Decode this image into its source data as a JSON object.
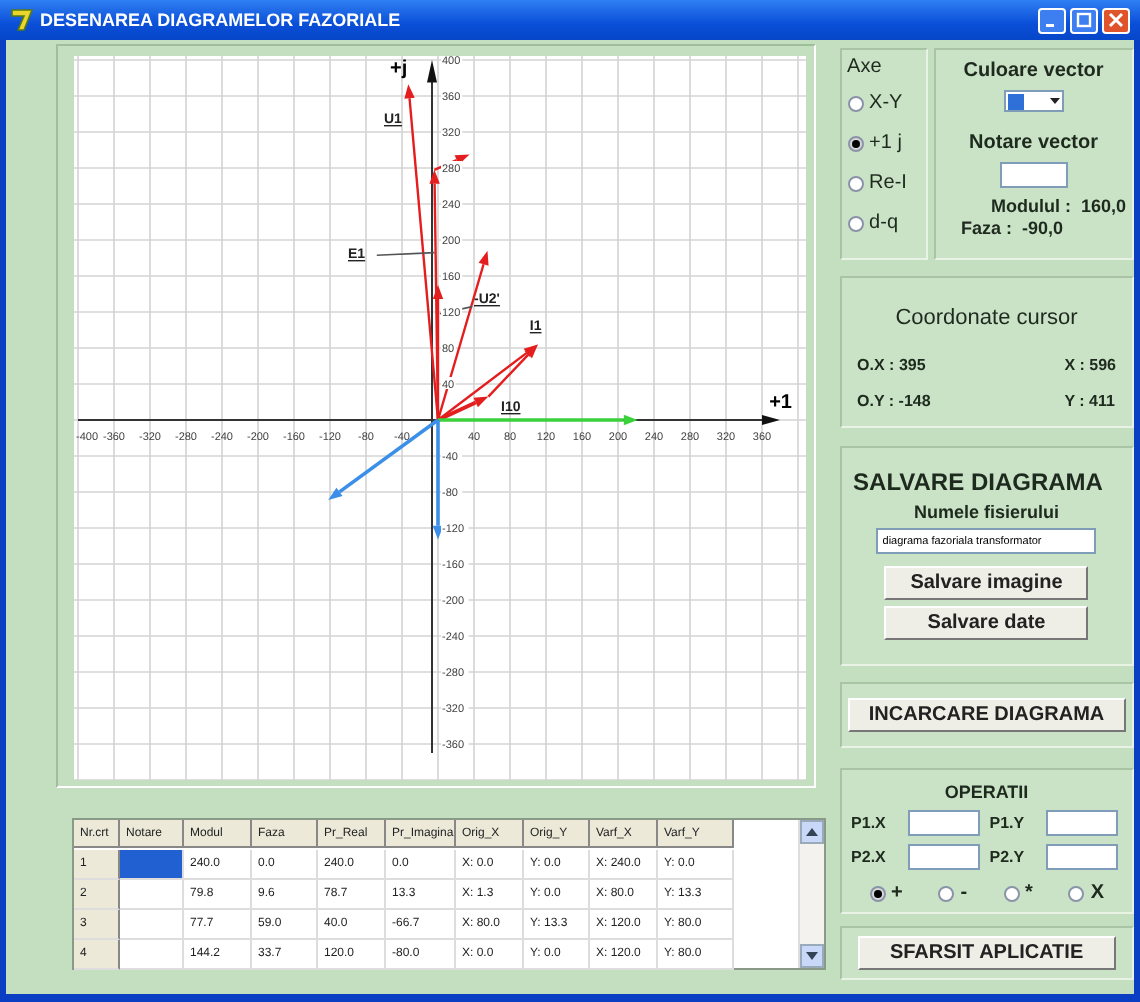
{
  "window": {
    "title": "DESENAREA DIAGRAMELOR FAZORIALE"
  },
  "plot": {
    "x_axis_label": "+1",
    "y_axis_label": "+j",
    "x_ticks": [
      "-400",
      "-360",
      "-320",
      "-280",
      "-240",
      "-200",
      "-160",
      "-120",
      "-80",
      "-40",
      "40",
      "80",
      "120",
      "160",
      "200",
      "240",
      "280",
      "320",
      "360"
    ],
    "y_ticks": [
      "400",
      "360",
      "320",
      "280",
      "240",
      "200",
      "160",
      "120",
      "80",
      "40",
      "-40",
      "-80",
      "-120",
      "-160",
      "-200",
      "-240",
      "-280",
      "-320",
      "-360"
    ],
    "vectors": [
      {
        "label": "U1",
        "color": "#e41e1e"
      },
      {
        "color": "#e41e1e"
      },
      {
        "color": "#e41e1e"
      },
      {
        "label": "E1",
        "color": "#e41e1e"
      },
      {
        "label": "-U2'",
        "color": "#e41e1e"
      },
      {
        "label": "I1",
        "color": "#e41e1e"
      },
      {
        "label": "I10",
        "color": "#e41e1e"
      },
      {
        "color": "#e41e1e"
      },
      {
        "color": "#3ad13a"
      },
      {
        "color": "#3b8fe8"
      },
      {
        "color": "#3b8fe8"
      }
    ]
  },
  "axes_group": {
    "title": "Axe",
    "options": [
      {
        "label": "X-Y",
        "selected": false
      },
      {
        "label": "+1 j",
        "selected": true
      },
      {
        "label": "Re-I",
        "selected": false
      },
      {
        "label": "d-q",
        "selected": false
      }
    ]
  },
  "vector_group": {
    "color_label": "Culoare vector",
    "color": "#2f6fd8",
    "notation_label": "Notare vector",
    "modulus": "Modulul :  160,0",
    "phase": "Faza :  -90,0"
  },
  "cursor": {
    "title": "Coordonate cursor",
    "ox": "O.X : 395",
    "x": "X : 596",
    "oy": "O.Y : -148",
    "y": "Y : 411"
  },
  "save": {
    "title": "SALVARE DIAGRAMA",
    "file_label": "Numele fisierului",
    "file_name": "diagrama fazoriala transformator",
    "buttons": [
      "Salvare imagine",
      "Salvare date"
    ]
  },
  "load_button": "INCARCARE DIAGRAMA",
  "operations": {
    "title": "OPERATII",
    "fields": [
      "P1.X",
      "P1.Y",
      "P2.X",
      "P2.Y"
    ],
    "options": [
      {
        "label": "+",
        "selected": true
      },
      {
        "label": "-",
        "selected": false
      },
      {
        "label": "*",
        "selected": false
      },
      {
        "label": "X",
        "selected": false
      }
    ]
  },
  "exit_button": "SFARSIT APLICATIE",
  "table": {
    "columns": [
      "Nr.crt",
      "Notare",
      "Modul",
      "Faza",
      "Pr_Real",
      "Pr_Imagina",
      "Orig_X",
      "Orig_Y",
      "Varf_X",
      "Varf_Y"
    ],
    "rows": [
      {
        "cells": [
          "1",
          "",
          "240.0",
          "0.0",
          "240.0",
          "0.0",
          "X: 0.0",
          "Y: 0.0",
          "X: 240.0",
          "Y: 0.0"
        ],
        "selected": true
      },
      {
        "cells": [
          "2",
          "",
          "79.8",
          "9.6",
          "78.7",
          "13.3",
          "X: 1.3",
          "Y: 0.0",
          "X: 80.0",
          "Y: 13.3"
        ],
        "selected": false
      },
      {
        "cells": [
          "3",
          "",
          "77.7",
          "59.0",
          "40.0",
          "-66.7",
          "X: 80.0",
          "Y: 13.3",
          "X: 120.0",
          "Y: 80.0"
        ],
        "selected": false
      },
      {
        "cells": [
          "4",
          "",
          "144.2",
          "33.7",
          "120.0",
          "-80.0",
          "X: 0.0",
          "Y: 0.0",
          "X: 120.0",
          "Y: 80.0"
        ],
        "selected": false
      }
    ]
  }
}
